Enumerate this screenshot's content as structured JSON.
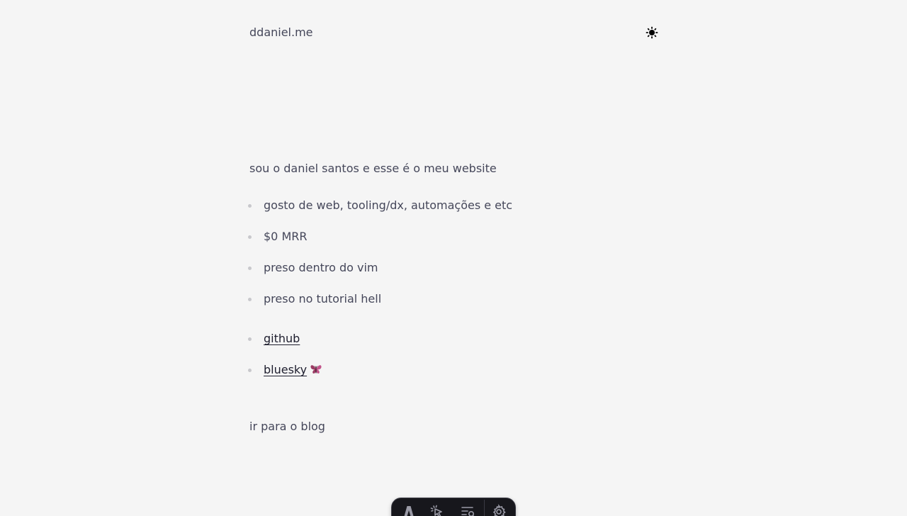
{
  "header": {
    "site_name": "ddaniel.me",
    "theme_toggle_icon": "sun-icon"
  },
  "intro": "sou o daniel santos e esse é o meu website",
  "facts": [
    "gosto de web, tooling/dx, automações e etc",
    "$0 MRR",
    "preso dentro do vim",
    "preso no tutorial hell"
  ],
  "links": [
    {
      "label": "github"
    },
    {
      "label": "bluesky",
      "icon": "butterfly-icon"
    }
  ],
  "blog_link": "ir para o blog",
  "devbar": {
    "tools": [
      "astro-logo-icon",
      "inspect-pointer-icon",
      "audit-list-icon",
      "settings-gear-icon"
    ]
  },
  "colors": {
    "background": "#f5f5f5",
    "text": "#45475a",
    "link": "#1e1e2e",
    "bullet": "#c8c8cc",
    "toolbar": "#17171c"
  }
}
